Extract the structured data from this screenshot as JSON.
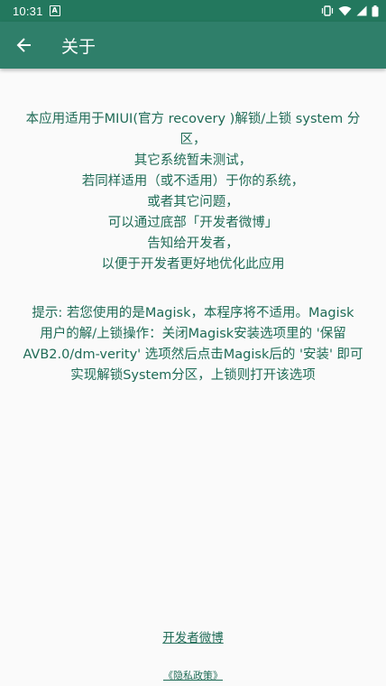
{
  "status_bar": {
    "time": "10:31",
    "app_icon_letter": "A",
    "icons": [
      "vibrate-icon",
      "wifi-icon",
      "signal-icon",
      "battery-icon"
    ]
  },
  "toolbar": {
    "back_icon": "arrow-back-icon",
    "title": "关于"
  },
  "main": {
    "description_lines": [
      "本应用适用于MIUI(官方 recovery )解锁/上锁 system 分",
      "区，",
      "其它系统暂未测试，",
      "若同样适用（或不适用）于你的系统，",
      "或者其它问题，",
      "可以通过底部「开发者微博」",
      "告知给开发者，",
      "以便于开发者更好地优化此应用"
    ],
    "tip_lines": [
      "提示: 若您使用的是Magisk，本程序将不适用。Magisk",
      "用户的解/上锁操作：关闭Magisk安装选项里的 '保留",
      "AVB2.0/dm-verity' 选项然后点击Magisk后的 '安装' 即可",
      "实现解锁System分区，上锁则打开该选项"
    ]
  },
  "footer": {
    "weibo_link": "开发者微博",
    "privacy_link": "《隐私政策》"
  },
  "colors": {
    "status_bar": "#23785e",
    "toolbar": "#2f7f6a",
    "text": "#1f6b56",
    "background": "#fafafa"
  }
}
